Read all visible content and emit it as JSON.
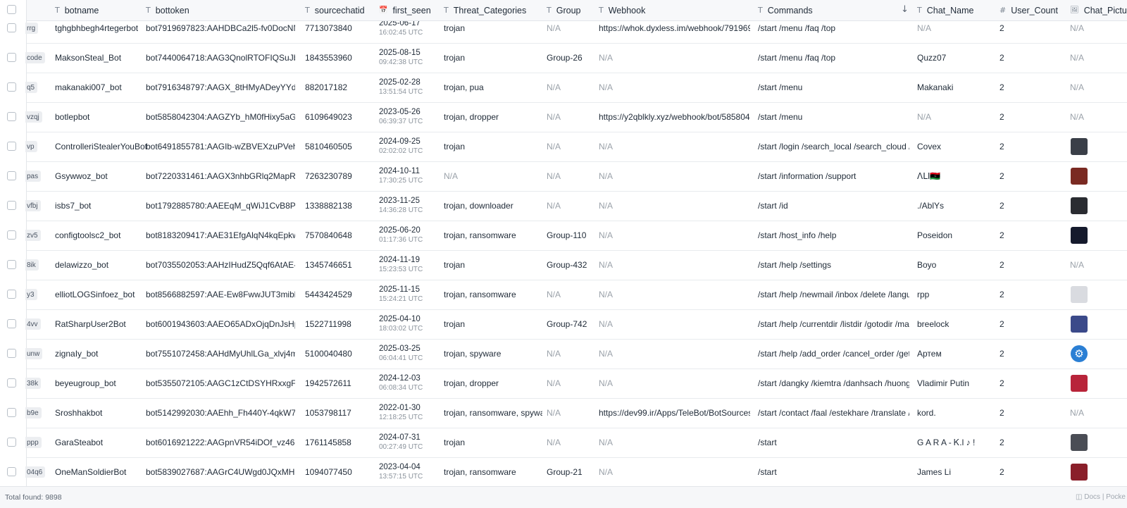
{
  "columns": [
    {
      "key": "botname",
      "label": "botname",
      "icon": "T"
    },
    {
      "key": "bottoken",
      "label": "bottoken",
      "icon": "T"
    },
    {
      "key": "sourcechatid",
      "label": "sourcechatid",
      "icon": "T"
    },
    {
      "key": "first_seen",
      "label": "first_seen",
      "icon": "calendar"
    },
    {
      "key": "threat",
      "label": "Threat_Categories",
      "icon": "T"
    },
    {
      "key": "group",
      "label": "Group",
      "icon": "T"
    },
    {
      "key": "webhook",
      "label": "Webhook",
      "icon": "T"
    },
    {
      "key": "commands",
      "label": "Commands",
      "icon": "T"
    },
    {
      "key": "chat_name",
      "label": "Chat_Name",
      "icon": "T"
    },
    {
      "key": "user_count",
      "label": "User_Count",
      "icon": "#"
    },
    {
      "key": "chat_picture",
      "label": "Chat_Picture",
      "icon": "image"
    }
  ],
  "sort": {
    "column": "Commands",
    "direction": "descending"
  },
  "rows": [
    {
      "id": "rrg",
      "botname": "tghgbhbegh4rtegerbot",
      "bottoken": "bot7919697823:AAHDBCa2l5-fv0DocNMORY…",
      "sourcechatid": "7713073840",
      "date": "2025-06-17",
      "time": "16:02:45 UTC",
      "threat": "trojan",
      "group": "N/A",
      "webhook": "https://whok.dyxless.im/webhook/7919697…",
      "commands": "/start /menu /faq /top",
      "chat_name": "N/A",
      "user_count": "2",
      "picture": "N/A",
      "pic_color": ""
    },
    {
      "id": "code",
      "botname": "MaksonSteal_Bot",
      "bottoken": "bot7440064718:AAG3QnolRTOFIQSuJbvU7…",
      "sourcechatid": "1843553960",
      "date": "2025-08-15",
      "time": "09:42:38 UTC",
      "threat": "trojan",
      "group": "Group-26",
      "webhook": "N/A",
      "commands": "/start /menu /faq /top",
      "chat_name": "Quzz07",
      "user_count": "2",
      "picture": "N/A",
      "pic_color": ""
    },
    {
      "id": "q5",
      "botname": "makanaki007_bot",
      "bottoken": "bot7916348797:AAGX_8tHMyADeyYYdkJ5gSi…",
      "sourcechatid": "882017182",
      "date": "2025-02-28",
      "time": "13:51:54 UTC",
      "threat": "trojan, pua",
      "group": "N/A",
      "webhook": "N/A",
      "commands": "/start /menu",
      "chat_name": "Makanaki",
      "user_count": "2",
      "picture": "N/A",
      "pic_color": ""
    },
    {
      "id": "vzqj",
      "botname": "botlepbot",
      "bottoken": "bot5858042304:AAGZYb_hM0fHixy5aGwFGP…",
      "sourcechatid": "6109649023",
      "date": "2023-05-26",
      "time": "06:39:37 UTC",
      "threat": "trojan, dropper",
      "group": "N/A",
      "webhook": "https://y2qblkly.xyz/webhook/bot/5858042…",
      "commands": "/start /menu",
      "chat_name": "N/A",
      "user_count": "2",
      "picture": "N/A",
      "pic_color": ""
    },
    {
      "id": "vp",
      "botname": "ControlleriStealerYouBot",
      "bottoken": "bot6491855781:AAGIb-wZBVEXzuPVeh3BVYr…",
      "sourcechatid": "5810460505",
      "date": "2024-09-25",
      "time": "02:02:02 UTC",
      "threat": "trojan",
      "group": "N/A",
      "webhook": "N/A",
      "commands": "/start /login /search_local /search_cloud /pr…",
      "chat_name": "Covex",
      "user_count": "2",
      "picture": "",
      "pic_color": "#3a3f48"
    },
    {
      "id": "pas",
      "botname": "Gsywwoz_bot",
      "bottoken": "bot7220331461:AAGX3nhbGRlq2MapR5mlfR…",
      "sourcechatid": "7263230789",
      "date": "2024-10-11",
      "time": "17:30:25 UTC",
      "threat": "N/A",
      "group": "N/A",
      "webhook": "N/A",
      "commands": "/start /information /support",
      "chat_name": "ꓥꓡꓲ🇱🇾",
      "user_count": "2",
      "picture": "",
      "pic_color": "#7a2a22"
    },
    {
      "id": "vfbj",
      "botname": "isbs7_bot",
      "bottoken": "bot1792885780:AAEEqM_qWiJ1CvB8Pmxkn…",
      "sourcechatid": "1338882138",
      "date": "2023-11-25",
      "time": "14:36:28 UTC",
      "threat": "trojan, downloader",
      "group": "N/A",
      "webhook": "N/A",
      "commands": "/start /id",
      "chat_name": "./AblYs",
      "user_count": "2",
      "picture": "",
      "pic_color": "#2a2c31"
    },
    {
      "id": "zv5",
      "botname": "configtoolsc2_bot",
      "bottoken": "bot8183209417:AAE31EfgAlqN4kqEpkwGxK…",
      "sourcechatid": "7570840648",
      "date": "2025-06-20",
      "time": "01:17:36 UTC",
      "threat": "trojan, ransomware",
      "group": "Group-110",
      "webhook": "N/A",
      "commands": "/start /host_info /help",
      "chat_name": "Poseidon",
      "user_count": "2",
      "picture": "",
      "pic_color": "#151a2c"
    },
    {
      "id": "8ik",
      "botname": "delawizzo_bot",
      "bottoken": "bot7035502053:AAHzIHudZ5Qqf6AtAE-KEZP…",
      "sourcechatid": "1345746651",
      "date": "2024-11-19",
      "time": "15:23:53 UTC",
      "threat": "trojan",
      "group": "Group-432",
      "webhook": "N/A",
      "commands": "/start /help /settings",
      "chat_name": "Boyo",
      "user_count": "2",
      "picture": "N/A",
      "pic_color": ""
    },
    {
      "id": "y3",
      "botname": "elliotLOGSinfoez_bot",
      "bottoken": "bot8566882597:AAE-Ew8FwwJUT3mibbY69…",
      "sourcechatid": "5443424529",
      "date": "2025-11-15",
      "time": "15:24:21 UTC",
      "threat": "trojan, ransomware",
      "group": "N/A",
      "webhook": "N/A",
      "commands": "/start /help /newmail /inbox /delete /langua…",
      "chat_name": "rpp",
      "user_count": "2",
      "picture": "",
      "pic_color": "#d9dbe0"
    },
    {
      "id": "4vv",
      "botname": "RatSharpUser2Bot",
      "bottoken": "bot6001943603:AAEO65ADxOjqDnJsHpd6_X…",
      "sourcechatid": "1522711998",
      "date": "2025-04-10",
      "time": "18:03:02 UTC",
      "threat": "trojan",
      "group": "Group-742",
      "webhook": "N/A",
      "commands": "/start /help /currentdir /listdir /gotodir /mak…",
      "chat_name": "breelock",
      "user_count": "2",
      "picture": "",
      "pic_color": "#3b4a8a"
    },
    {
      "id": "unw",
      "botname": "zignaIy_bot",
      "bottoken": "bot7551072458:AAHdMyUhlLGa_xlvj4mRIpB…",
      "sourcechatid": "5100040480",
      "date": "2025-03-25",
      "time": "06:04:41 UTC",
      "threat": "trojan, spyware",
      "group": "N/A",
      "webhook": "N/A",
      "commands": "/start /help /add_order /cancel_order /get_…",
      "chat_name": "Артем",
      "user_count": "2",
      "picture": "",
      "pic_color": "#2b7fd4"
    },
    {
      "id": "38k",
      "botname": "beyeugroup_bot",
      "bottoken": "bot5355072105:AAGC1zCtDSYHRxxgFxWl350…",
      "sourcechatid": "1942572611",
      "date": "2024-12-03",
      "time": "06:08:34 UTC",
      "threat": "trojan, dropper",
      "group": "N/A",
      "webhook": "N/A",
      "commands": "/start /dangky /kiemtra /danhsach /huongd…",
      "chat_name": "Vladimir Putin",
      "user_count": "2",
      "picture": "",
      "pic_color": "#b8243a"
    },
    {
      "id": "b9e",
      "botname": "Sroshhakbot",
      "bottoken": "bot5142992030:AAEhh_Fh440Y-4qkW7q0Z4…",
      "sourcechatid": "1053798117",
      "date": "2022-01-30",
      "time": "12:18:25 UTC",
      "threat": "trojan, ransomware, spyware",
      "group": "N/A",
      "webhook": "https://dev99.ir/Apps/TeleBot/BotSources/Z…",
      "commands": "/start /contact /faal /estekhare /translate /sc…",
      "chat_name": "kord.",
      "user_count": "2",
      "picture": "N/A",
      "pic_color": ""
    },
    {
      "id": "ppp",
      "botname": "GaraSteabot",
      "bottoken": "bot6016921222:AAGpnVR54iDOf_vz46kSNzu…",
      "sourcechatid": "1761145858",
      "date": "2024-07-31",
      "time": "00:27:49 UTC",
      "threat": "trojan",
      "group": "N/A",
      "webhook": "N/A",
      "commands": "/start",
      "chat_name": "G A R A - Ꮶ.Ɩ ♪ !",
      "user_count": "2",
      "picture": "",
      "pic_color": "#4a4d55"
    },
    {
      "id": "04q6",
      "botname": "OneManSoldierBot",
      "bottoken": "bot5839027687:AAGrC4UWgd0JQxMHOf1dC…",
      "sourcechatid": "1094077450",
      "date": "2023-04-04",
      "time": "13:57:15 UTC",
      "threat": "trojan, ransomware",
      "group": "Group-21",
      "webhook": "N/A",
      "commands": "/start",
      "chat_name": "James Li",
      "user_count": "2",
      "picture": "",
      "pic_color": "#8a1f2a"
    }
  ],
  "footer": {
    "total_label": "Total found:",
    "total_count": "9898",
    "docs_label": "Docs",
    "pocket_label": "Pocke"
  }
}
